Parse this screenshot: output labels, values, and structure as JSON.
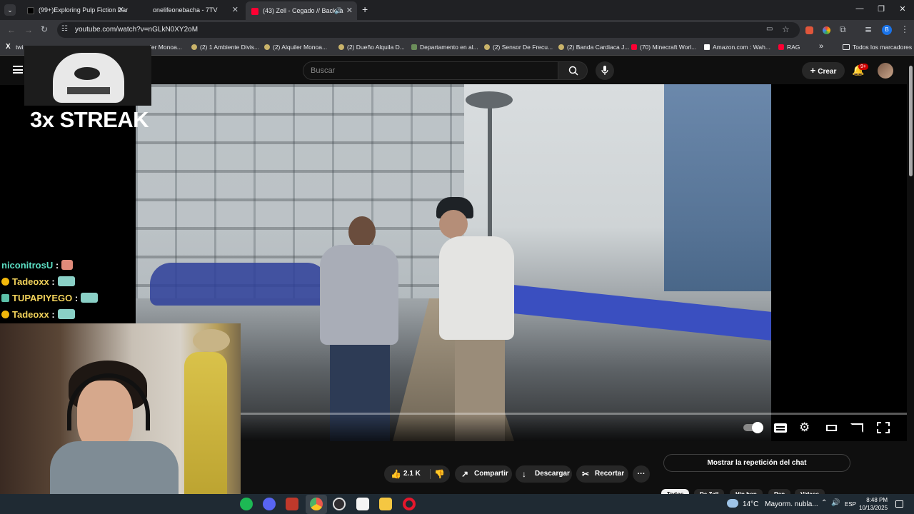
{
  "tabs": [
    {
      "title": "(99+)Exploring Pulp Fiction Dar",
      "close": "✕"
    },
    {
      "title": "onelifeonebacha - 7TV",
      "close": "✕"
    },
    {
      "title": "(43) Zell - Cegado // Backpa",
      "close": "✕"
    }
  ],
  "new_tab": "+",
  "window_controls": {
    "minimize": "—",
    "restore": "❐",
    "close": "✕"
  },
  "address": {
    "url": "youtube.com/watch?v=nGLkN0XY2oM"
  },
  "bookmarks": [
    {
      "label": "twi"
    },
    {
      "label": "ler Monoa..."
    },
    {
      "label": "(2) 1 Ambiente Divis..."
    },
    {
      "label": "(2) Alquiler Monoa..."
    },
    {
      "label": "(2) Dueño Alquila D..."
    },
    {
      "label": "Departamento en al..."
    },
    {
      "label": "(2) Sensor De Frecu..."
    },
    {
      "label": "(2) Banda Cardiaca J..."
    },
    {
      "label": "(70) Minecraft Worl..."
    },
    {
      "label": "Amazon.com : Wah..."
    },
    {
      "label": "RAG"
    }
  ],
  "bookmarks_overflow": "»",
  "all_bookmarks": "Todos los marcadores",
  "youtube": {
    "search_placeholder": "Buscar",
    "create_label": "Crear",
    "notif_count": "9+"
  },
  "overlay": {
    "streak_text": "3x STREAK",
    "chat": [
      {
        "user": "niconitrosU",
        "color": "#5cdfc4",
        "badge": false
      },
      {
        "user": "Tadeoxx",
        "color": "#f2d25b",
        "badge": true
      },
      {
        "user": "TUPAPIYEGO",
        "color": "#f2d25b",
        "badge": false
      },
      {
        "user": "Tadeoxx",
        "color": "#f2d25b",
        "badge": true
      }
    ]
  },
  "actions": {
    "likes": "2.1 K",
    "share": "Compartir",
    "download": "Descargar",
    "clip": "Recortar",
    "more": "···"
  },
  "chat_replay_label": "Mostrar la repetición del chat",
  "chips": [
    "Todos",
    "De Zell",
    "Hip hop",
    "Rap",
    "Videos"
  ],
  "taskbar": {
    "weather_temp": "14°C",
    "weather_desc": "Mayorm. nubla...",
    "lang": "ESP",
    "time": "8:48 PM",
    "date": "10/13/2025"
  }
}
